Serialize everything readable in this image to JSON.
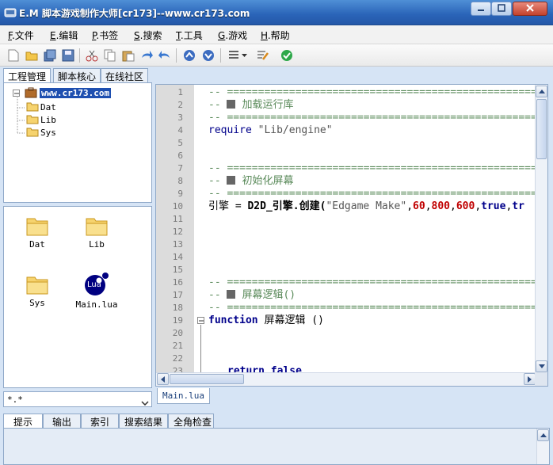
{
  "window": {
    "title": "E.M 脚本游戏制作大师[cr173]--www.cr173.com",
    "icons": [
      "app-icon",
      "minimize-icon",
      "maximize-icon",
      "close-icon"
    ]
  },
  "menu": [
    {
      "key": "F",
      "label": ".文件"
    },
    {
      "key": "E",
      "label": ".编辑"
    },
    {
      "key": "P",
      "label": ".书签"
    },
    {
      "key": "S",
      "label": ".搜索"
    },
    {
      "key": "T",
      "label": ".工具"
    },
    {
      "key": "G",
      "label": ".游戏"
    },
    {
      "key": "H",
      "label": ".帮助"
    }
  ],
  "toolbar_icons": [
    "new-file-icon",
    "open-folder-icon",
    "save-all-icon",
    "save-icon",
    "cut-icon",
    "copy-icon",
    "paste-icon",
    "redo-icon",
    "undo-icon",
    "nav-up-icon",
    "nav-down-icon",
    "list-icon",
    "dropdown-arrow-icon",
    "edit-icon",
    "check-icon"
  ],
  "left_tabs": [
    "工程管理",
    "脚本核心",
    "在线社区"
  ],
  "tree": {
    "root": "www.cr173.com",
    "children": [
      "Dat",
      "Lib",
      "Sys"
    ]
  },
  "icon_view": [
    "Dat",
    "Lib",
    "Sys",
    "Main.lua"
  ],
  "lua_badge": "Lua",
  "filter": "*.*",
  "editor": {
    "line_numbers": [
      "1",
      "2",
      "3",
      "4",
      "5",
      "6",
      "7",
      "8",
      "9",
      "10",
      "11",
      "12",
      "13",
      "14",
      "15",
      "16",
      "17",
      "18",
      "19",
      "20",
      "21",
      "22",
      "23"
    ],
    "sep": "-- ================================================================",
    "comments": {
      "l2_prefix": "-- ",
      "l2_text": "加载运行库",
      "l8_prefix": "-- ",
      "l8_text": "初始化屏幕",
      "l17_prefix": "-- ",
      "l17_text": "屏幕逻辑()"
    },
    "l4": {
      "kw": "require",
      "str": "\"Lib/engine\""
    },
    "l10": {
      "lhs": "引擎 = ",
      "fn": "D2D_引擎.创建(",
      "str": "\"Edgame Make\"",
      "c1": ",",
      "n1": "60",
      "c2": ",",
      "n2": "800",
      "c3": ",",
      "n3": "600",
      "c4": ",",
      "kw1": "true",
      "c5": ",",
      "kw2": "tr"
    },
    "l19": {
      "kw": "function",
      "name": " 屏幕逻辑 ()"
    },
    "l23": {
      "kw": "return false"
    }
  },
  "file_tab": "Main.lua",
  "bottom_tabs": [
    "提示",
    "输出",
    "索引",
    "搜索结果",
    "全角检查"
  ],
  "colors": {
    "titlebar": "#2a64b8",
    "gutter": "#dcdcdc",
    "comment": "#5a8a5a",
    "keyword": "#00008b",
    "number": "#c00000"
  }
}
